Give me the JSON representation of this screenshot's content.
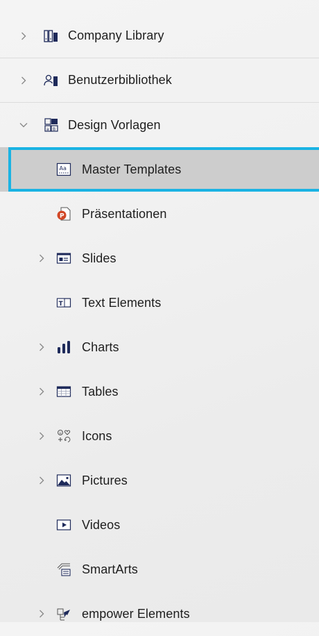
{
  "tree": {
    "items": [
      {
        "label": "Company Library",
        "icon": "library-books-icon",
        "expanded": false
      },
      {
        "label": "Benutzerbibliothek",
        "icon": "user-library-icon",
        "expanded": false
      },
      {
        "label": "Design Vorlagen",
        "icon": "design-templates-icon",
        "expanded": true,
        "children": [
          {
            "label": "Master Templates",
            "icon": "master-template-icon",
            "selected": true
          },
          {
            "label": "Präsentationen",
            "icon": "powerpoint-file-icon"
          },
          {
            "label": "Slides",
            "icon": "slide-icon",
            "expandable": true
          },
          {
            "label": "Text Elements",
            "icon": "text-element-icon"
          },
          {
            "label": "Charts",
            "icon": "bar-chart-icon",
            "expandable": true
          },
          {
            "label": "Tables",
            "icon": "table-icon",
            "expandable": true
          },
          {
            "label": "Icons",
            "icon": "icons-icon",
            "expandable": true
          },
          {
            "label": "Pictures",
            "icon": "picture-icon",
            "expandable": true
          },
          {
            "label": "Videos",
            "icon": "video-icon"
          },
          {
            "label": "SmartArts",
            "icon": "smartart-icon"
          },
          {
            "label": "empower Elements",
            "icon": "empower-elements-icon",
            "expandable": true
          }
        ]
      }
    ]
  },
  "colors": {
    "selection_border": "#1ab3e3",
    "selection_fill": "#cdcdcd",
    "icon_navy": "#1e2a5a",
    "ppt_orange": "#d24726"
  }
}
